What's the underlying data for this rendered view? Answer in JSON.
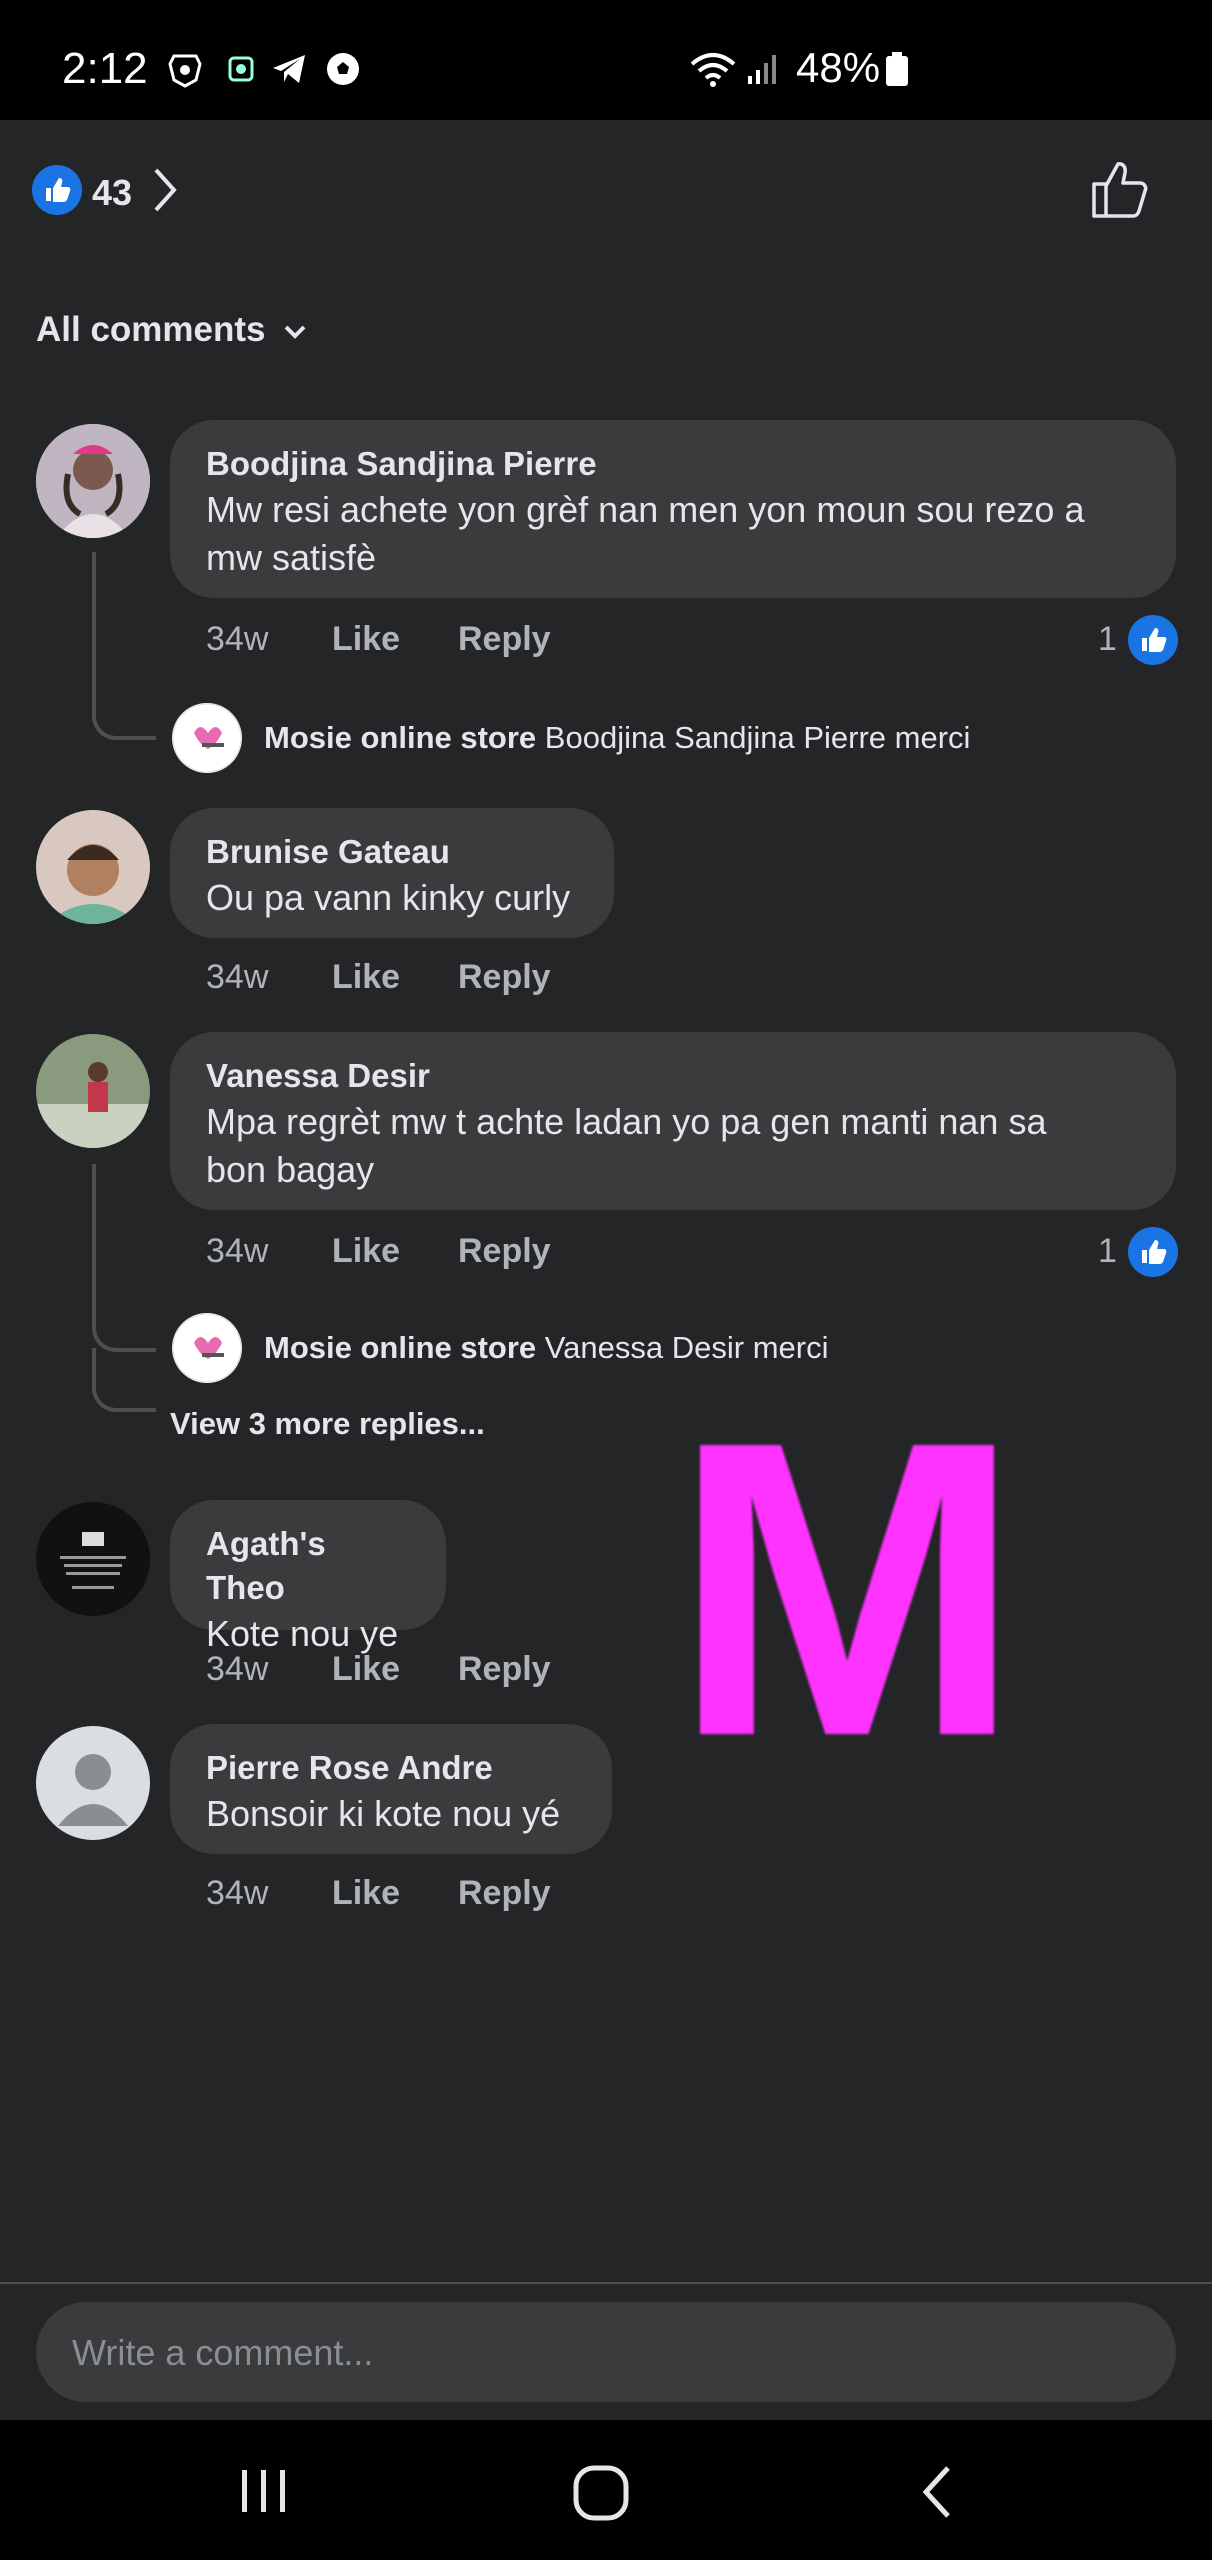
{
  "status_bar": {
    "time": "2:12",
    "battery": "48%",
    "icons": [
      "brave-icon",
      "app-icon",
      "telegram-icon",
      "soccer-icon",
      "wifi-icon",
      "signal-icon",
      "battery-icon"
    ]
  },
  "reactions": {
    "count": "43"
  },
  "sort": {
    "label": "All comments"
  },
  "comments": [
    {
      "name": "Boodjina Sandjina Pierre",
      "text_line1": "Mw resi achete yon grèf nan men yon moun sou rezo a",
      "text_line2": "mw satisfè",
      "time": "34w",
      "like": "Like",
      "reply": "Reply",
      "reaction_count": "1",
      "reply_item": {
        "name": "Mosie online store",
        "text": "Boodjina Sandjina Pierre merci"
      }
    },
    {
      "name": "Brunise Gateau",
      "text_line1": "Ou pa vann kinky curly",
      "time": "34w",
      "like": "Like",
      "reply": "Reply"
    },
    {
      "name": "Vanessa Desir",
      "text_line1": "Mpa regrèt mw t achte ladan yo pa gen manti nan sa",
      "text_line2": "bon bagay",
      "time": "34w",
      "like": "Like",
      "reply": "Reply",
      "reaction_count": "1",
      "reply_item": {
        "name": "Mosie online store",
        "text": "Vanessa Desir merci"
      },
      "view_more": "View 3 more replies..."
    },
    {
      "name": "Agath's Theo",
      "text_line1": "Kote nou ye",
      "time": "34w",
      "like": "Like",
      "reply": "Reply"
    },
    {
      "name": "Pierre Rose Andre",
      "text_line1": "Bonsoir ki kote nou yé",
      "time": "34w",
      "like": "Like",
      "reply": "Reply"
    }
  ],
  "watermark": "M",
  "composer": {
    "placeholder": "Write a comment..."
  },
  "colors": {
    "background": "#242526",
    "bubble": "#3a3b3c",
    "accent": "#1b74e4",
    "watermark": "#ff33ff"
  }
}
